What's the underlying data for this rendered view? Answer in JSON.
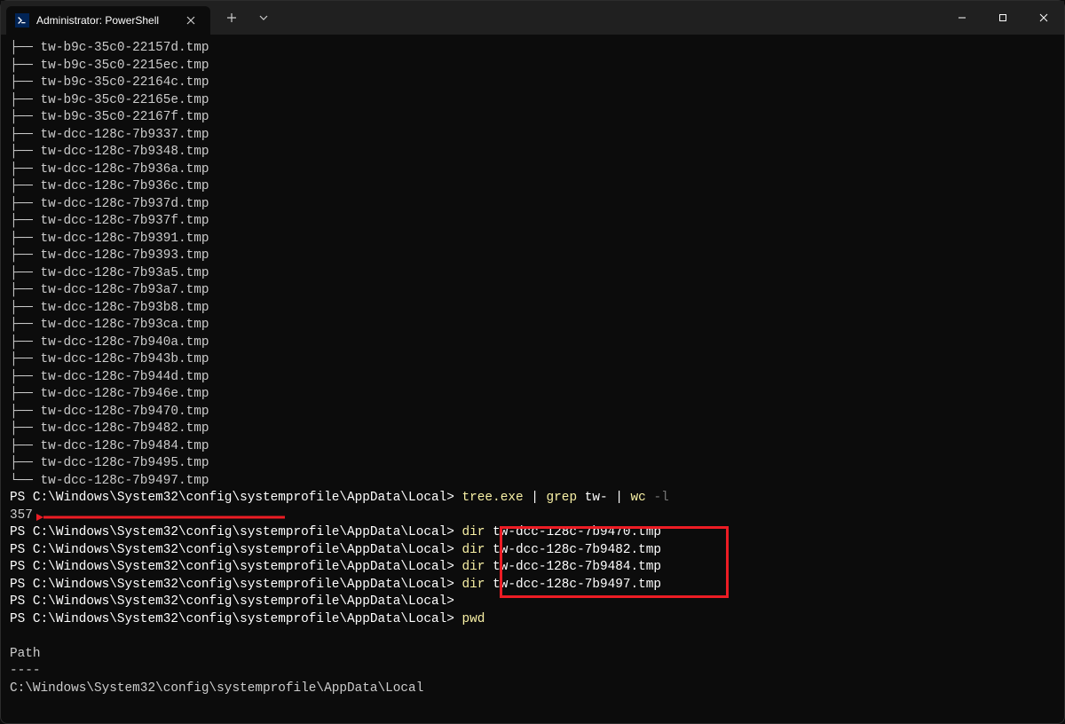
{
  "titlebar": {
    "tab_title": "Administrator: PowerShell",
    "new_tab_icon": "+",
    "dropdown_icon": "⌄",
    "minimize_icon": "—",
    "maximize_icon": "□",
    "close_icon": "✕"
  },
  "terminal": {
    "tree_files": [
      "tw-b9c-35c0-22157d.tmp",
      "tw-b9c-35c0-2215ec.tmp",
      "tw-b9c-35c0-22164c.tmp",
      "tw-b9c-35c0-22165e.tmp",
      "tw-b9c-35c0-22167f.tmp",
      "tw-dcc-128c-7b9337.tmp",
      "tw-dcc-128c-7b9348.tmp",
      "tw-dcc-128c-7b936a.tmp",
      "tw-dcc-128c-7b936c.tmp",
      "tw-dcc-128c-7b937d.tmp",
      "tw-dcc-128c-7b937f.tmp",
      "tw-dcc-128c-7b9391.tmp",
      "tw-dcc-128c-7b9393.tmp",
      "tw-dcc-128c-7b93a5.tmp",
      "tw-dcc-128c-7b93a7.tmp",
      "tw-dcc-128c-7b93b8.tmp",
      "tw-dcc-128c-7b93ca.tmp",
      "tw-dcc-128c-7b940a.tmp",
      "tw-dcc-128c-7b943b.tmp",
      "tw-dcc-128c-7b944d.tmp",
      "tw-dcc-128c-7b946e.tmp",
      "tw-dcc-128c-7b9470.tmp",
      "tw-dcc-128c-7b9482.tmp",
      "tw-dcc-128c-7b9484.tmp",
      "tw-dcc-128c-7b9495.tmp",
      "tw-dcc-128c-7b9497.tmp"
    ],
    "tree_branch_mid": "├── ",
    "tree_branch_last": "└── ",
    "prompt_prefix": "PS ",
    "prompt_path": "C:\\Windows\\System32\\config\\systemprofile\\AppData\\Local",
    "prompt_suffix": "> ",
    "cmd_tree": "tree.exe",
    "pipe": " | ",
    "cmd_grep": "grep",
    "grep_arg": " tw-",
    "cmd_wc": "wc",
    "wc_flag": " -l",
    "count_result": "357",
    "dir_cmds": [
      {
        "cmd": "dir",
        "arg": " tw-dcc-128c-7b9470.tmp"
      },
      {
        "cmd": "dir",
        "arg": " tw-dcc-128c-7b9482.tmp"
      },
      {
        "cmd": "dir",
        "arg": " tw-dcc-128c-7b9484.tmp"
      },
      {
        "cmd": "dir",
        "arg": " tw-dcc-128c-7b9497.tmp"
      }
    ],
    "cmd_pwd": "pwd",
    "pwd_header": "Path",
    "pwd_divider": "----",
    "pwd_value": "C:\\Windows\\System32\\config\\systemprofile\\AppData\\Local"
  },
  "annotations": {
    "arrow_color": "#ed1c24",
    "box_color": "#ed1c24"
  }
}
